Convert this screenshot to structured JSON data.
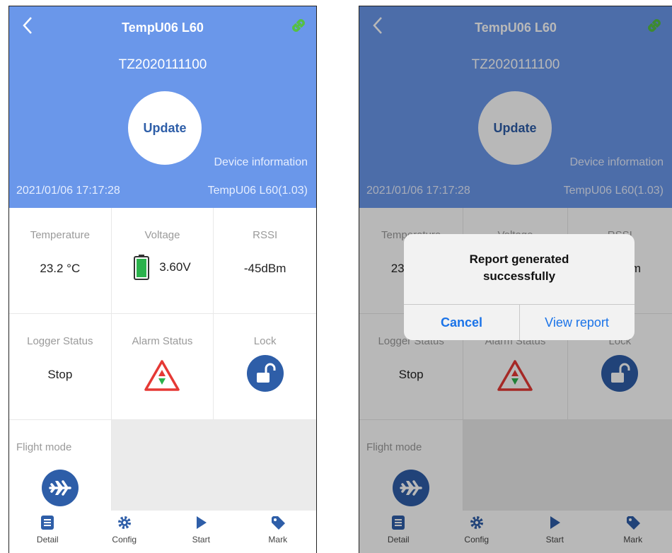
{
  "device": {
    "title": "TempU06 L60",
    "serial": "TZ2020111100",
    "update_label": "Update",
    "device_info_label": "Device information",
    "datetime": "2021/01/06 17:17:28",
    "firmware": "TempU06 L60(1.03)"
  },
  "metrics": {
    "temperature_label": "Temperature",
    "temperature_value": "23.2 °C",
    "voltage_label": "Voltage",
    "voltage_value": "3.60V",
    "rssi_label": "RSSI",
    "rssi_value": "-45dBm",
    "logger_status_label": "Logger Status",
    "logger_status_value": "Stop",
    "alarm_status_label": "Alarm Status",
    "lock_label": "Lock",
    "flight_mode_label": "Flight mode"
  },
  "tabs": [
    "Detail",
    "Config",
    "Start",
    "Mark"
  ],
  "dialog": {
    "line1": "Report generated",
    "line2": "successfully",
    "cancel": "Cancel",
    "view_report": "View report"
  },
  "colors": {
    "header_blue": "#6a97ea",
    "icon_blue": "#2e5ea8",
    "battery_green": "#2bb24c",
    "link_green": "#55c043",
    "alarm_red": "#e53935",
    "dialog_blue": "#1a73e8"
  },
  "icons": {
    "back": "chevron-left-icon",
    "link": "link-icon",
    "battery": "battery-icon",
    "alarm": "warning-triangle-icon",
    "lock": "unlock-icon",
    "flight": "airplane-icon",
    "detail": "document-icon",
    "config": "gear-icon",
    "start": "play-icon",
    "mark": "tag-icon"
  }
}
